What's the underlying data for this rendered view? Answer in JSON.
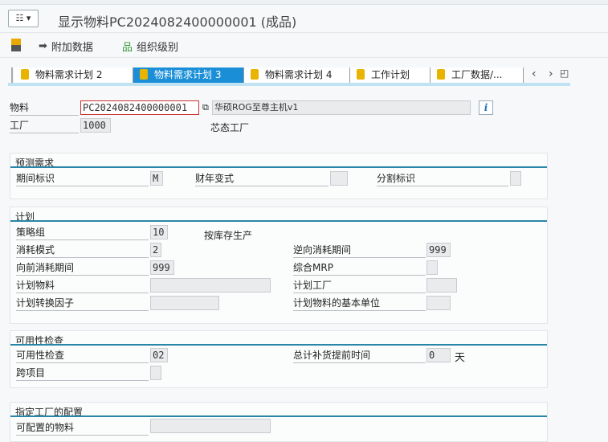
{
  "window": {
    "title": "显示物料PC2024082400000001 (成品)"
  },
  "toolbar": {
    "additional_data": "附加数据",
    "org_levels": "组织级别"
  },
  "tabs": [
    {
      "label": "物料需求计划 2"
    },
    {
      "label": "物料需求计划 3",
      "active": true
    },
    {
      "label": "物料需求计划 4"
    },
    {
      "label": "工作计划"
    },
    {
      "label": "工厂数据/..."
    }
  ],
  "header": {
    "material_label": "物料",
    "material_value": "PC2024082400000001",
    "material_desc": "华硕ROG至尊主机v1",
    "plant_label": "工厂",
    "plant_value": "1000",
    "plant_desc": "芯态工厂"
  },
  "forecast": {
    "title": "预测需求",
    "period_label": "期间标识",
    "period_value": "M",
    "fy_label": "财年变式",
    "fy_value": "",
    "split_label": "分割标识",
    "split_value": ""
  },
  "planning": {
    "title": "计划",
    "strategy_label": "策略组",
    "strategy_value": "10",
    "strategy_desc": "按库存生产",
    "consump_mode_label": "消耗模式",
    "consump_mode_value": "2",
    "bwd_label": "逆向消耗期间",
    "bwd_value": "999",
    "fwd_label": "向前消耗期间",
    "fwd_value": "999",
    "mixed_mrp_label": "综合MRP",
    "mixed_mrp_value": "",
    "plan_mat_label": "计划物料",
    "plan_mat_value": "",
    "plan_plant_label": "计划工厂",
    "plan_plant_value": "",
    "conv_label": "计划转换因子",
    "conv_value": "",
    "base_unit_label": "计划物料的基本单位",
    "base_unit_value": ""
  },
  "availability": {
    "title": "可用性检查",
    "check_label": "可用性检查",
    "check_value": "02",
    "tot_rlt_label": "总计补货提前时间",
    "tot_rlt_value": "0",
    "tot_rlt_unit": "天",
    "cross_label": "跨项目",
    "cross_value": ""
  },
  "config": {
    "title": "指定工厂的配置",
    "configurable_label": "可配置的物料",
    "configurable_value": ""
  }
}
